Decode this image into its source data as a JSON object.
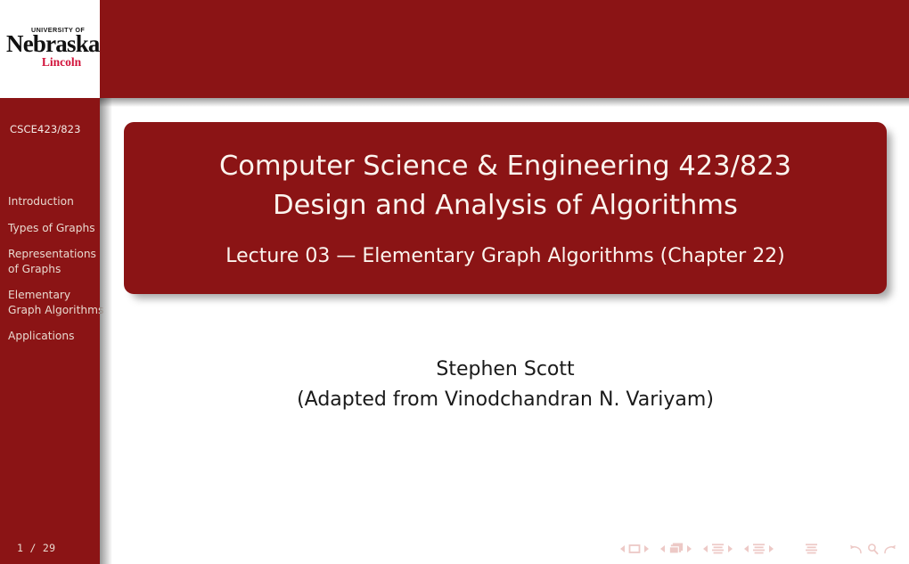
{
  "meta": {
    "brand_red": "#8b1415",
    "logo_red": "#d1123a",
    "sidebar_text": "#e8d9cf",
    "title_text": "#fbf4ee",
    "nav_symbol_color": "#edc9c6"
  },
  "logo": {
    "line1": "UNIVERSITY OF",
    "line2": "Nebraska",
    "line3": "Lincoln"
  },
  "sidebar": {
    "course_label": "CSCE423/823",
    "items": [
      {
        "label": "Introduction"
      },
      {
        "label": "Types of Graphs"
      },
      {
        "label": "Representations of Graphs"
      },
      {
        "label": "Elementary Graph Algorithms"
      },
      {
        "label": "Applications"
      }
    ],
    "page_indicator": "1 / 29"
  },
  "title_block": {
    "line1": "Computer Science & Engineering 423/823",
    "line2": "Design and Analysis of Algorithms",
    "subtitle": "Lecture 03 — Elementary Graph Algorithms (Chapter 22)"
  },
  "author_block": {
    "name": "Stephen Scott",
    "note": "(Adapted from Vinodchandran N. Variyam)"
  },
  "navigation_symbols": [
    {
      "name": "slide-nav",
      "icon": "single-frame-icon"
    },
    {
      "name": "frame-nav",
      "icon": "stacked-frames-icon"
    },
    {
      "name": "subsection-nav",
      "icon": "subsection-bars-icon"
    },
    {
      "name": "section-nav",
      "icon": "section-bars-icon"
    },
    {
      "name": "presentation-nav",
      "icon": "document-bars-icon"
    },
    {
      "name": "back-nav",
      "icon": "back-arrow-icon"
    },
    {
      "name": "search-nav",
      "icon": "search-icon"
    },
    {
      "name": "forward-nav",
      "icon": "forward-arrow-icon"
    }
  ]
}
